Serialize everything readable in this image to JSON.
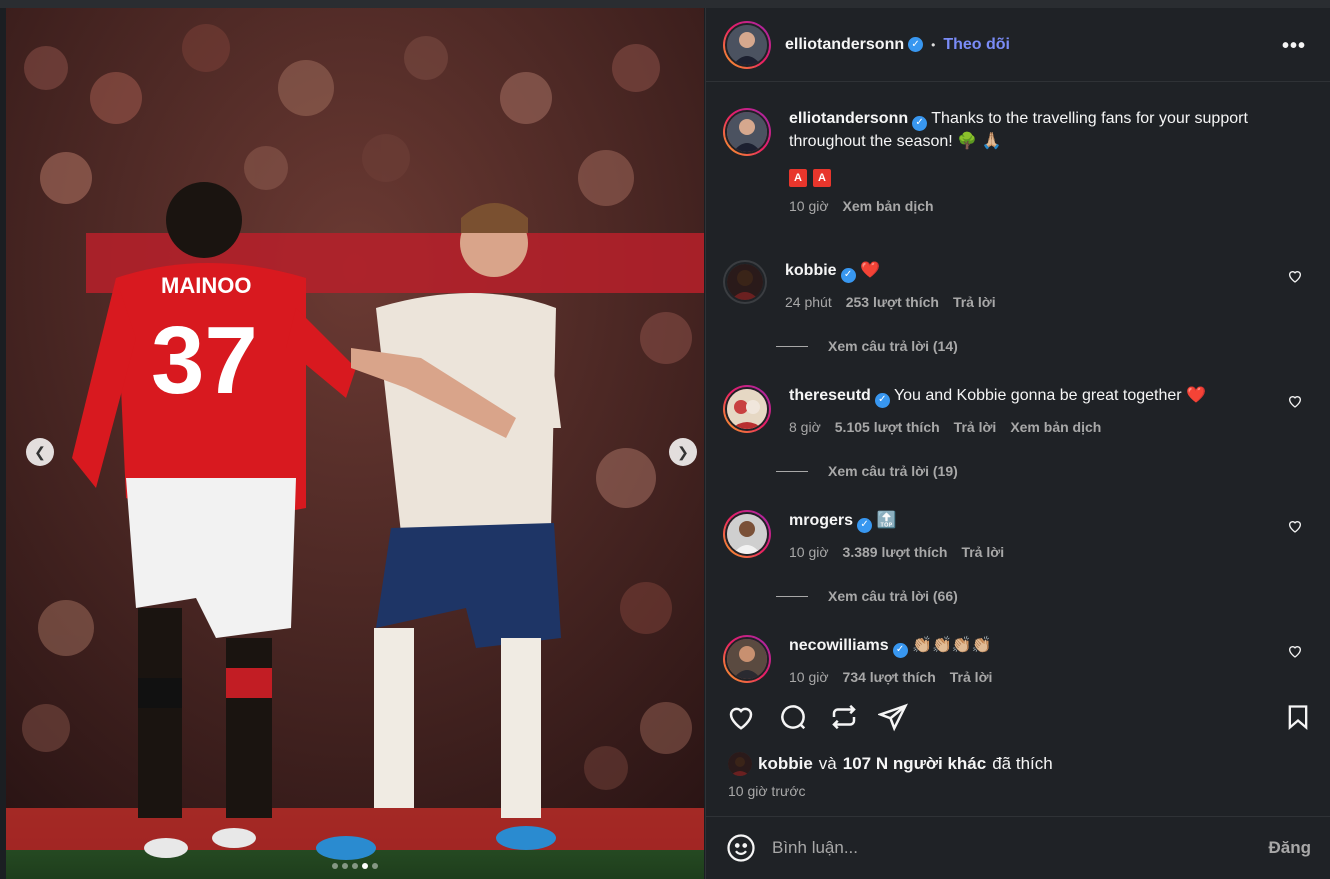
{
  "post": {
    "author": "elliotandersonn",
    "follow_label": "Theo dõi",
    "more_label": "•••",
    "caption": "Thanks to the travelling fans for your support throughout the season! 🌳 🙏🏼",
    "caption_badge": "A",
    "caption_time": "10 giờ",
    "translate_label": "Xem bản dịch"
  },
  "comments": [
    {
      "user": "kobbie",
      "text": "❤️",
      "time": "24 phút",
      "likes": "253 lượt thích",
      "reply": "Trả lời",
      "view_replies": "Xem câu trả lời (14)"
    },
    {
      "user": "thereseutd",
      "text": "You and Kobbie gonna be great together ❤️",
      "time": "8 giờ",
      "likes": "5.105 lượt thích",
      "reply": "Trả lời",
      "translate": "Xem bản dịch",
      "view_replies": "Xem câu trả lời (19)"
    },
    {
      "user": "mrogers",
      "text": "🔝",
      "time": "10 giờ",
      "likes": "3.389 lượt thích",
      "reply": "Trả lời",
      "view_replies": "Xem câu trả lời (66)"
    },
    {
      "user": "necowilliams",
      "text": "👏🏼👏🏼👏🏼👏🏼",
      "time": "10 giờ",
      "likes": "734 lượt thích",
      "reply": "Trả lời"
    }
  ],
  "likes_line": {
    "user": "kobbie",
    "and": "và",
    "others": "107 N người khác",
    "suffix": "đã thích"
  },
  "time_ago": "10 giờ trước",
  "comment_box": {
    "placeholder": "Bình luận...",
    "post_label": "Đăng"
  },
  "photo": {
    "jersey_name": "MAINOO",
    "jersey_number": "37"
  },
  "colors": {
    "accent": "#7a8cf7",
    "verified": "#3897f0",
    "heart": "#ed4956"
  }
}
